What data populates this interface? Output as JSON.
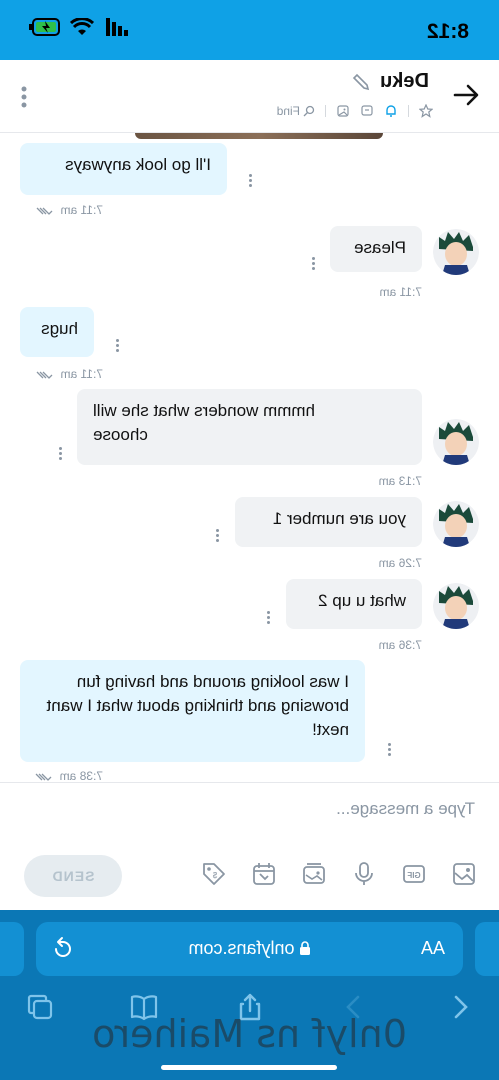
{
  "status_bar": {
    "time": "8:12"
  },
  "header": {
    "title": "Deku",
    "find_label": "Find"
  },
  "messages": [
    {
      "text": "I'll go look anyways",
      "time": "7:11 am",
      "dir": "in"
    },
    {
      "text": "Please",
      "time": "7:11 am",
      "dir": "out"
    },
    {
      "text": "hugs",
      "time": "7:11 am",
      "dir": "in"
    },
    {
      "text": "hmmm wonders what she will choose",
      "time": "7:13 am",
      "dir": "out"
    },
    {
      "text": "you are number 1",
      "time": "7:26 am",
      "dir": "out"
    },
    {
      "text": "what u up 2",
      "time": "7:36 am",
      "dir": "out"
    },
    {
      "text": "I was looking around and having fun browsing and thinking about what I want next!",
      "time": "7:38 am",
      "dir": "in"
    }
  ],
  "composer": {
    "placeholder": "Type a message...",
    "send_label": "SEND"
  },
  "browser": {
    "text_size_label": "AA",
    "url": "onlyfans.com"
  },
  "watermark": "0nlyf ns Maihero"
}
